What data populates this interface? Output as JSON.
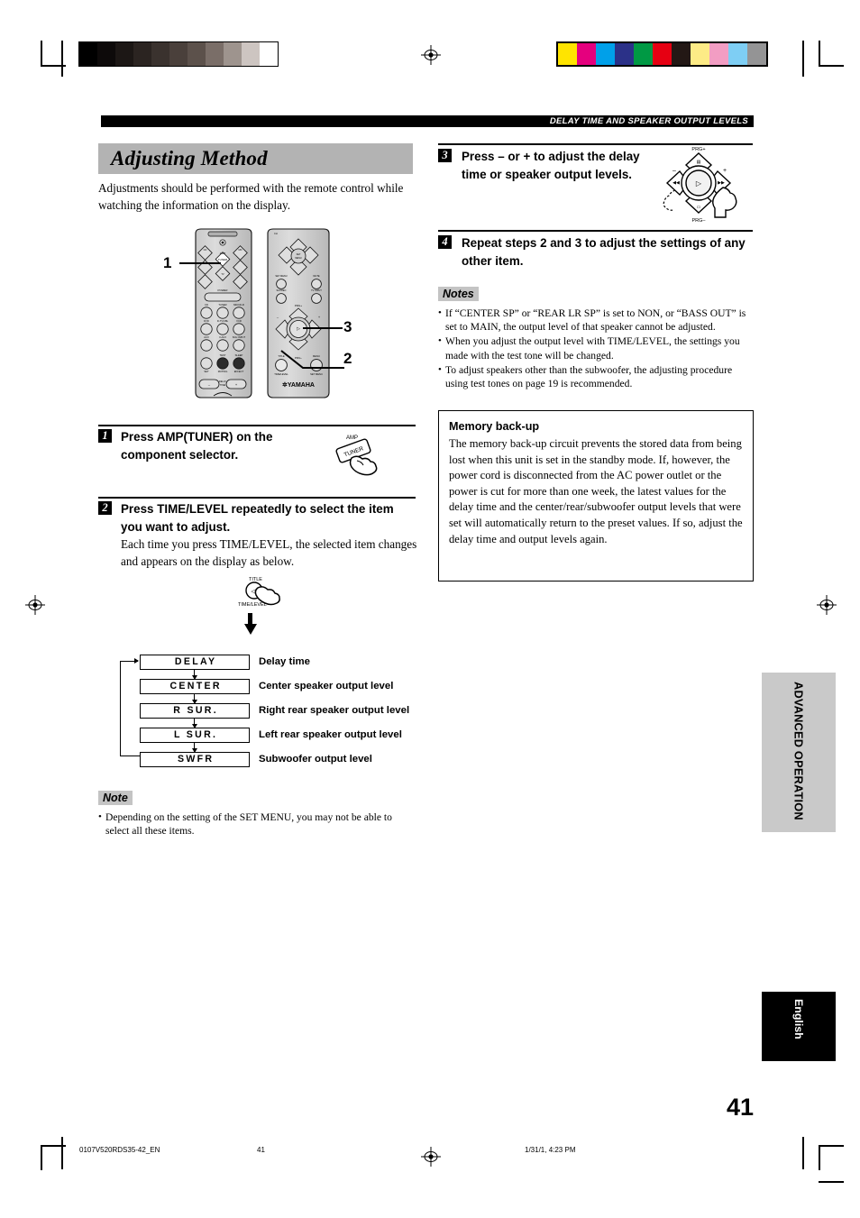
{
  "header": {
    "running_head": "DELAY TIME AND SPEAKER OUTPUT LEVELS"
  },
  "section": {
    "title": "Adjusting Method",
    "intro": "Adjustments should be performed with the remote control while watching the information on the display."
  },
  "steps": [
    {
      "num": "1",
      "heading": "Press AMP(TUNER) on the component selector.",
      "icon_labels": {
        "top": "AMP",
        "button": "TUNER"
      }
    },
    {
      "num": "2",
      "heading": "Press TIME/LEVEL repeatedly to select the item you want to adjust.",
      "body": "Each time you press TIME/LEVEL, the selected item changes and appears on the display as below.",
      "icon_labels": {
        "top": "TITLE",
        "button": "TIME/LEVEL"
      }
    },
    {
      "num": "3",
      "heading": "Press – or + to adjust the delay time or speaker output levels.",
      "icon_labels": {
        "top": "PRG+",
        "bottom": "PRG–",
        "left": "–",
        "right": "+"
      }
    },
    {
      "num": "4",
      "heading": "Repeat steps 2 and 3 to adjust the settings of any other item."
    }
  ],
  "flow": {
    "rows": [
      {
        "display": "DELAY",
        "description": "Delay time"
      },
      {
        "display": "CENTER",
        "description": "Center speaker output level"
      },
      {
        "display": "R SUR.",
        "description": "Right rear speaker output level"
      },
      {
        "display": "L SUR.",
        "description": "Left rear speaker output level"
      },
      {
        "display": "SWFR",
        "description": "Subwoofer output level"
      }
    ]
  },
  "note_left": {
    "label": "Note",
    "items": [
      "Depending on the setting of the SET MENU, you may not be able to select all these items."
    ]
  },
  "notes_right": {
    "label": "Notes",
    "items": [
      "If “CENTER SP” or “REAR LR SP” is set to NON, or “BASS OUT” is set to MAIN, the output level of that speaker cannot be adjusted.",
      "When you adjust the output level with TIME/LEVEL, the settings you made with the test tone will be changed.",
      "To adjust speakers other than the subwoofer, the adjusting procedure using test tones on page 19 is recommended."
    ]
  },
  "memory_box": {
    "title": "Memory back-up",
    "text": "The memory back-up circuit prevents the stored data from being lost when this unit is set in the standby mode. If, however, the power cord is disconnected from the AC power outlet or the power is cut for more than one week, the latest values for the delay time and the center/rear/subwoofer output levels that were set will automatically return to the preset values. If so, adjust the delay time and output levels again."
  },
  "side_tabs": {
    "chapter": "ADVANCED OPERATION",
    "language": "English"
  },
  "page_number": "41",
  "footer": {
    "file": "0107V520RDS35-42_EN",
    "page": "41",
    "timestamp": "1/31/1, 4:23 PM"
  },
  "remote": {
    "callouts": [
      "1",
      "3",
      "2"
    ],
    "brand": "YAMAHA",
    "left_remote_labels": [
      "CD",
      "MD",
      "TAPE",
      "TV",
      "VCR",
      "DVD",
      "POWER",
      "CD",
      "TUNER",
      "MD/CD-R",
      "DVD",
      "D-TV/CBL",
      "VCR",
      "AUX",
      "V-AUX",
      "6CH INPUT",
      "TEST",
      "MUTING",
      "SLEEP",
      "EFFECT",
      "DELAY TIME",
      "+",
      "–"
    ],
    "right_remote_labels": [
      "SET MENU",
      "MUTE",
      "SLEEP",
      "TV INPUT",
      "PRG+",
      "PRG–",
      "TITLE",
      "TIME/LEVEL",
      "MENU",
      "DVD",
      "SET MENU"
    ]
  },
  "registration": {
    "gray_ramp": [
      "#000000",
      "#0d0a0a",
      "#1c1715",
      "#2b2421",
      "#3a322e",
      "#4a403b",
      "#5c514b",
      "#7a6e68",
      "#9e948e",
      "#cdc5c1",
      "#ffffff"
    ],
    "color_bars": [
      "#ffe400",
      "#e5007e",
      "#00a0e9",
      "#2b3188",
      "#009944",
      "#e60012",
      "#231815",
      "#fdeb86",
      "#f29dc3",
      "#7ecef4",
      "#949495"
    ]
  }
}
